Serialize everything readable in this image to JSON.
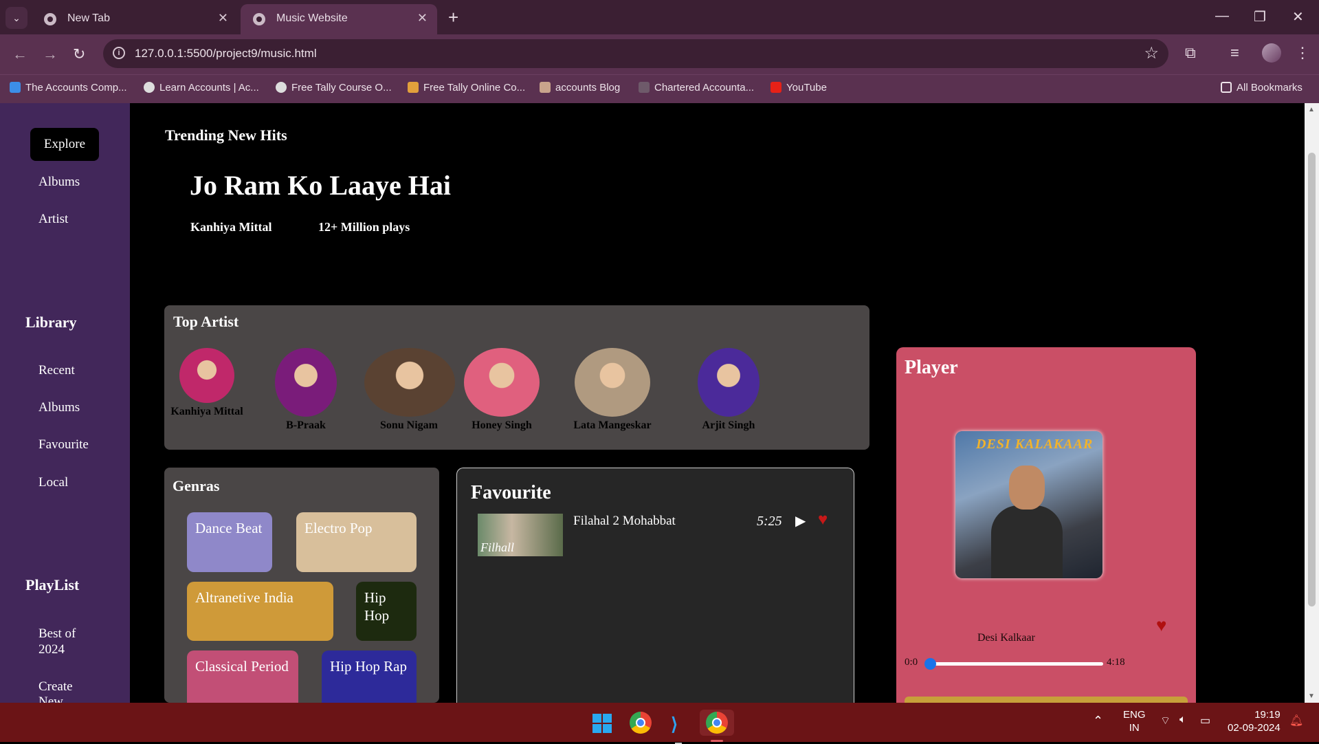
{
  "browser": {
    "tabs": [
      {
        "title": "New Tab"
      },
      {
        "title": "Music Website"
      }
    ],
    "url": "127.0.0.1:5500/project9/music.html",
    "bookmarks": [
      "The Accounts Comp...",
      "Learn Accounts | Ac...",
      "Free Tally Course O...",
      "Free Tally Online Co...",
      "accounts Blog",
      "Chartered Accounta...",
      "YouTube"
    ],
    "all_bookmarks": "All Bookmarks"
  },
  "sidebar": {
    "menu": [
      "Explore",
      "Albums",
      "Artist"
    ],
    "library_heading": "Library",
    "library": [
      "Recent",
      "Albums",
      "Favourite",
      "Local"
    ],
    "playlist_heading": "PlayList",
    "playlist": [
      "Best of 2024",
      "Create New"
    ]
  },
  "main": {
    "trending_heading": "Trending New Hits",
    "hero": {
      "title": "Jo Ram Ko Laaye Hai",
      "artist": "Kanhiya Mittal",
      "plays": "12+ Million plays"
    },
    "top_artist": {
      "heading": "Top Artist",
      "artists": [
        {
          "name": "Kanhiya Mittal",
          "color": "#c0286a"
        },
        {
          "name": "B-Praak",
          "color": "#7a1c7a"
        },
        {
          "name": "Sonu Nigam",
          "color": "#5a4232"
        },
        {
          "name": "Honey Singh",
          "color": "#e0607e"
        },
        {
          "name": "Lata Mangeskar",
          "color": "#b09a80"
        },
        {
          "name": "Arjit Singh",
          "color": "#4b2a9a"
        }
      ]
    },
    "genres": {
      "heading": "Genras",
      "items": [
        {
          "label": "Dance Beat",
          "color": "#8f88c9"
        },
        {
          "label": "Electro Pop",
          "color": "#d8bf9b"
        },
        {
          "label": "Altranetive India",
          "color": "#cf9a39"
        },
        {
          "label": "Hip Hop",
          "color": "#1d2a0f"
        },
        {
          "label": "Classical Period",
          "color": "#c24f76"
        },
        {
          "label": "Hip Hop Rap",
          "color": "#2d2a9a"
        }
      ]
    },
    "favourite": {
      "heading": "Favourite",
      "items": [
        {
          "thumb_text": "Filhall",
          "title": "Filahal 2 Mohabbat",
          "duration": "5:25"
        }
      ]
    },
    "player": {
      "heading": "Player",
      "album_text": "DESI KALAKAAR",
      "song": "Desi Kalkaar",
      "current_time": "0:0",
      "duration": "4:18",
      "progress": 0
    }
  },
  "taskbar": {
    "language": "ENG",
    "region": "IN",
    "time": "19:19",
    "date": "02-09-2024"
  }
}
